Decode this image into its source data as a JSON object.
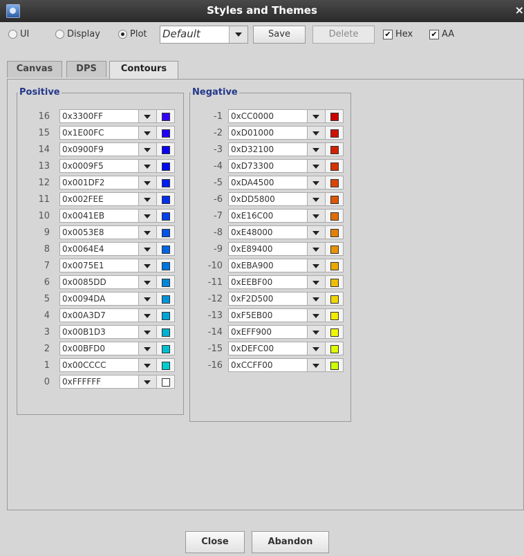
{
  "window": {
    "title": "Styles and Themes",
    "close_glyph": "×"
  },
  "toolbar": {
    "radios": [
      {
        "label": "UI",
        "selected": false
      },
      {
        "label": "Display",
        "selected": false
      },
      {
        "label": "Plot",
        "selected": true
      }
    ],
    "theme_value": "Default",
    "save_label": "Save",
    "delete_label": "Delete",
    "hex_label": "Hex",
    "hex_checked": true,
    "aa_label": "AA",
    "aa_checked": true,
    "check_glyph": "✔"
  },
  "tabs": [
    {
      "label": "Canvas",
      "active": false
    },
    {
      "label": "DPS",
      "active": false
    },
    {
      "label": "Contours",
      "active": true
    }
  ],
  "positive": {
    "title": "Positive",
    "rows": [
      {
        "level": "16",
        "hex": "0x3300FF",
        "color": "#3300FF"
      },
      {
        "level": "15",
        "hex": "0x1E00FC",
        "color": "#1E00FC"
      },
      {
        "level": "14",
        "hex": "0x0900F9",
        "color": "#0900F9"
      },
      {
        "level": "13",
        "hex": "0x0009F5",
        "color": "#0009F5"
      },
      {
        "level": "12",
        "hex": "0x001DF2",
        "color": "#001DF2"
      },
      {
        "level": "11",
        "hex": "0x002FEE",
        "color": "#002FEE"
      },
      {
        "level": "10",
        "hex": "0x0041EB",
        "color": "#0041EB"
      },
      {
        "level": "9",
        "hex": "0x0053E8",
        "color": "#0053E8"
      },
      {
        "level": "8",
        "hex": "0x0064E4",
        "color": "#0064E4"
      },
      {
        "level": "7",
        "hex": "0x0075E1",
        "color": "#0075E1"
      },
      {
        "level": "6",
        "hex": "0x0085DD",
        "color": "#0085DD"
      },
      {
        "level": "5",
        "hex": "0x0094DA",
        "color": "#0094DA"
      },
      {
        "level": "4",
        "hex": "0x00A3D7",
        "color": "#00A3D7"
      },
      {
        "level": "3",
        "hex": "0x00B1D3",
        "color": "#00B1D3"
      },
      {
        "level": "2",
        "hex": "0x00BFD0",
        "color": "#00BFD0"
      },
      {
        "level": "1",
        "hex": "0x00CCCC",
        "color": "#00CCCC"
      },
      {
        "level": "0",
        "hex": "0xFFFFFF",
        "color": "#FFFFFF"
      }
    ]
  },
  "negative": {
    "title": "Negative",
    "rows": [
      {
        "level": "-1",
        "hex": "0xCC0000",
        "color": "#CC0000"
      },
      {
        "level": "-2",
        "hex": "0xD01000",
        "color": "#D01000"
      },
      {
        "level": "-3",
        "hex": "0xD32100",
        "color": "#D32100"
      },
      {
        "level": "-4",
        "hex": "0xD73300",
        "color": "#D73300"
      },
      {
        "level": "-5",
        "hex": "0xDA4500",
        "color": "#DA4500"
      },
      {
        "level": "-6",
        "hex": "0xDD5800",
        "color": "#DD5800"
      },
      {
        "level": "-7",
        "hex": "0xE16C00",
        "color": "#E16C00"
      },
      {
        "level": "-8",
        "hex": "0xE48000",
        "color": "#E48000"
      },
      {
        "level": "-9",
        "hex": "0xE89400",
        "color": "#E89400"
      },
      {
        "level": "-10",
        "hex": "0xEBA900",
        "color": "#EBA900"
      },
      {
        "level": "-11",
        "hex": "0xEEBF00",
        "color": "#EEBF00"
      },
      {
        "level": "-12",
        "hex": "0xF2D500",
        "color": "#F2D500"
      },
      {
        "level": "-13",
        "hex": "0xF5EB00",
        "color": "#F5EB00"
      },
      {
        "level": "-14",
        "hex": "0xEFF900",
        "color": "#EFF900"
      },
      {
        "level": "-15",
        "hex": "0xDEFC00",
        "color": "#DEFC00"
      },
      {
        "level": "-16",
        "hex": "0xCCFF00",
        "color": "#CCFF00"
      }
    ]
  },
  "footer": {
    "close_label": "Close",
    "abandon_label": "Abandon"
  },
  "icons": {
    "app": "app-icon",
    "dropdown": "chevron-down-icon",
    "swatch": "color-swatch-icon"
  }
}
